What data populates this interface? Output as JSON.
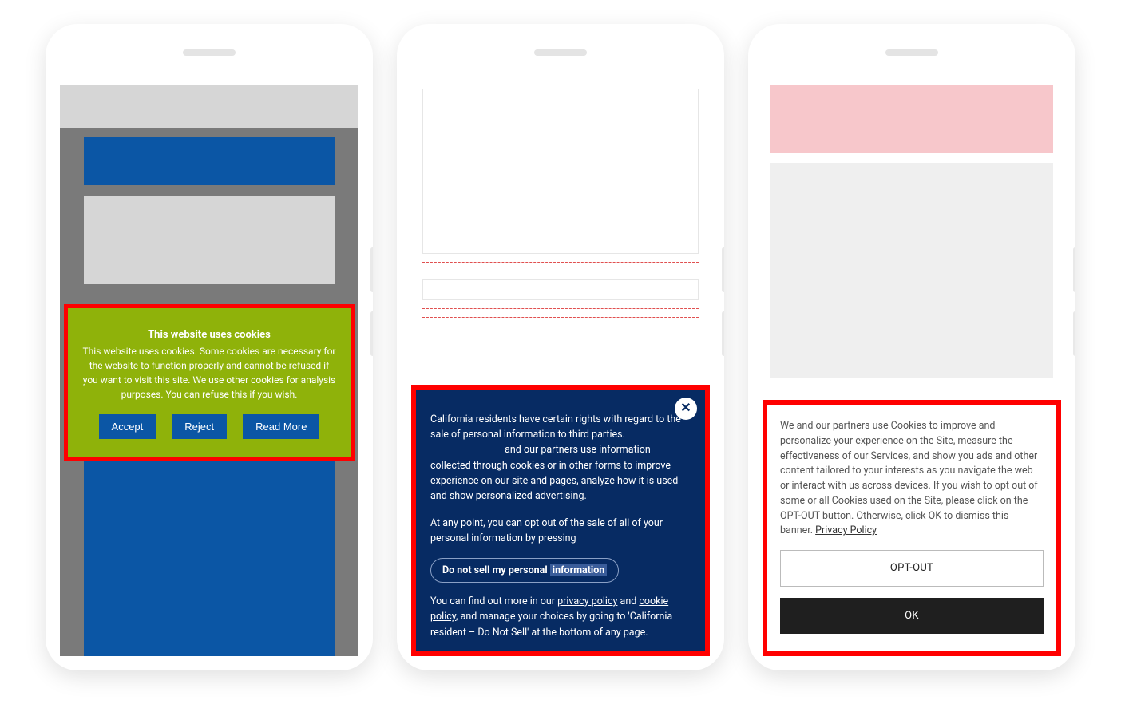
{
  "phone1": {
    "banner": {
      "title": "This website uses cookies",
      "text": "This website uses cookies. Some cookies are necessary for the website to function properly and cannot be refused if you want to visit this site. We use other cookies for analysis purposes. You can refuse this if you wish.",
      "accept": "Accept",
      "reject": "Reject",
      "more": "Read More"
    }
  },
  "phone2": {
    "banner": {
      "para1_a": "California residents have certain rights with regard to the sale of personal information to third parties.",
      "para1_b": "and our partners use information collected through cookies or in other forms to improve experience on our site and pages, analyze how it is used and show personalized advertising.",
      "para2": "At any point, you can opt out of the sale of all of your personal information by pressing",
      "chip_a": "Do not sell my personal ",
      "chip_b": "information",
      "para3_a": "You can find out more in our ",
      "link_privacy": "privacy policy",
      "and": " and ",
      "link_cookie": "cookie policy",
      "para3_b": ", and manage your choices by going to 'California resident – Do Not Sell' at the bottom of any page.",
      "close_glyph": "✕"
    }
  },
  "phone3": {
    "banner": {
      "text": "We and our partners use Cookies to improve and personalize your experience on the Site, measure the effectiveness of our Services, and show you ads and other content tailored to your interests as you navigate the web or interact with us across devices. If you wish to opt out of some or all Cookies used on the Site, please click on the OPT-OUT button. Otherwise, click OK to dismiss this banner. ",
      "link_privacy": "Privacy Policy",
      "optout": "OPT-OUT",
      "ok": "OK"
    }
  }
}
